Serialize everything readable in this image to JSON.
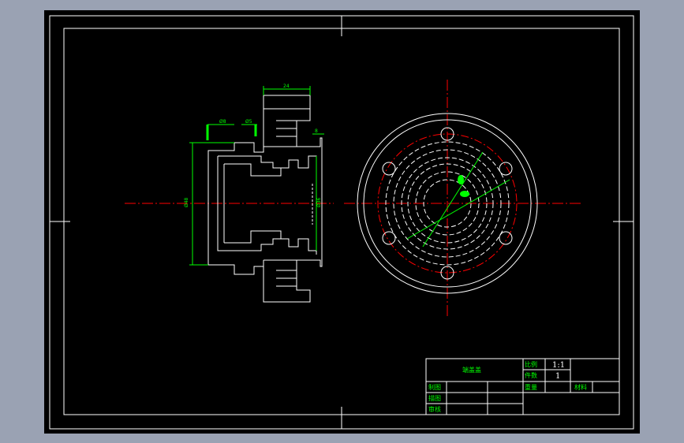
{
  "colors": {
    "background": "#9aa2b3",
    "canvas": "#000000",
    "line": "#ffffff",
    "dimension": "#00ff00",
    "centerline": "#ff0000",
    "label_green": "#00ff00"
  },
  "drawing": {
    "dimensions": {
      "top_width": "24",
      "left_a": "Ø8",
      "left_b": "Ø5",
      "right_small": "8",
      "overall_height": "Ø48",
      "inner_height": "Ø36"
    }
  },
  "title_block": {
    "part_name": "端盖盖",
    "scale_label": "比例",
    "scale_value": "1:1",
    "count_label": "件数",
    "count_value": "1",
    "weight_label": "重量",
    "material_label": "材料",
    "drawn_label": "制图",
    "designed_label": "描图",
    "checked_label": "审核"
  }
}
